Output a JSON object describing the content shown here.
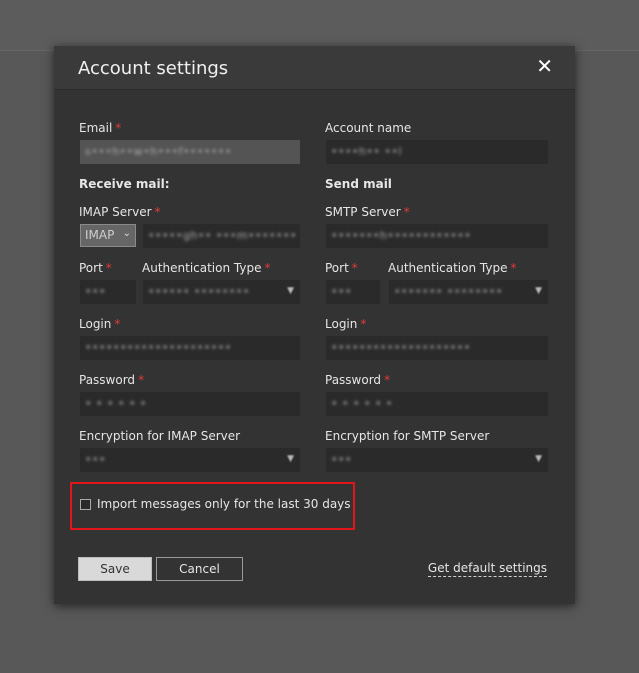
{
  "dialog": {
    "title": "Account settings",
    "close_symbol": "✕"
  },
  "form": {
    "email": {
      "label": "Email",
      "value": "s•••h••w•h•••f•••••••"
    },
    "account_name": {
      "label": "Account name",
      "value": "••••h•• ••l"
    },
    "receive_heading": "Receive mail:",
    "send_heading": "Send mail",
    "imap_server": {
      "label": "IMAP Server",
      "protocol": "IMAP",
      "value": "•••••gh•• •••m•••••••"
    },
    "smtp_server": {
      "label": "SMTP Server",
      "value": "•••••••h••••••••••••"
    },
    "imap_port": {
      "label": "Port",
      "value": "•••"
    },
    "imap_auth": {
      "label": "Authentication Type",
      "value": "•••••• ••••••••"
    },
    "smtp_port": {
      "label": "Port",
      "value": "•••"
    },
    "smtp_auth": {
      "label": "Authentication Type",
      "value": "••••••• ••••••••"
    },
    "imap_login": {
      "label": "Login",
      "value": "•••••••••••••••••••••"
    },
    "smtp_login": {
      "label": "Login",
      "value": "••••••••••••••••••••"
    },
    "imap_password": {
      "label": "Password",
      "value": "• • • • • •"
    },
    "smtp_password": {
      "label": "Password",
      "value": "• • • • • •"
    },
    "imap_encryption": {
      "label": "Encryption for IMAP Server",
      "value": "•••"
    },
    "smtp_encryption": {
      "label": "Encryption for SMTP Server",
      "value": "•••"
    },
    "required_marker": "*"
  },
  "import_option": {
    "label": "Import messages only for the last 30 days",
    "checked": false
  },
  "actions": {
    "save": "Save",
    "cancel": "Cancel",
    "default_settings": "Get default settings"
  },
  "colors": {
    "highlight": "#e0161b",
    "required": "#e03a3a"
  }
}
